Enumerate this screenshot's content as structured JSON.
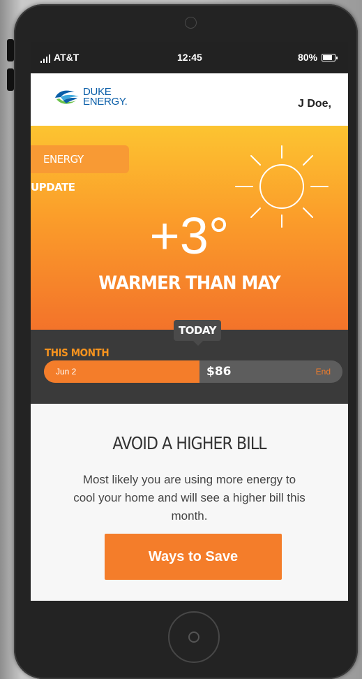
{
  "status_bar": {
    "carrier": "AT&T",
    "time": "12:45",
    "battery": "80%"
  },
  "header": {
    "brand_line1": "DUKE",
    "brand_line2": "ENERGY.",
    "user": "J Doe,"
  },
  "hero": {
    "tag_regular": "ENERGY ",
    "tag_bold": "UPDATE",
    "temperature_delta": "+3°",
    "headline": "WARMER THAN MAY",
    "weather_icon": "sun-icon"
  },
  "billing": {
    "today_label": "TODAY",
    "period_label": "THIS MONTH",
    "start_label": "Jun 2",
    "amount": "$86",
    "end_label": "End",
    "progress_fraction": 0.52
  },
  "tip": {
    "title": "AVOID A HIGHER BILL",
    "body": "Most likely you are using more energy to cool your home and will see a higher bill this month.",
    "button_label": "Ways to Save"
  },
  "colors": {
    "brand_orange": "#f47d2a",
    "brand_blue": "#0a5ea8",
    "hero_top": "#fcc431",
    "dark_panel": "#3a3a3a"
  }
}
